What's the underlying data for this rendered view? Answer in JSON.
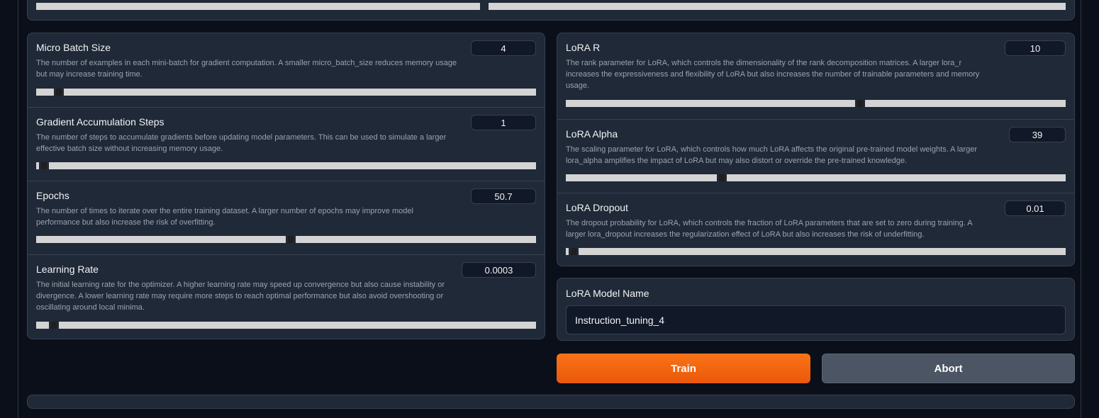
{
  "left_params": [
    {
      "label": "Micro Batch Size",
      "description_lines": [
        "The number of examples in each mini-batch for gradient computation. A smaller micro_batch_size reduces memory usage",
        "but may increase training time."
      ],
      "value": "4",
      "slider_fraction": 0.04
    },
    {
      "label": "Gradient Accumulation Steps",
      "description_lines": [
        "The number of steps to accumulate gradients before updating model parameters. This can be used to simulate a larger",
        "effective batch size without increasing memory usage."
      ],
      "value": "1",
      "slider_fraction": 0.01
    },
    {
      "label": "Epochs",
      "description_lines": [
        "The number of times to iterate over the entire training dataset. A larger number of epochs may improve model",
        "performance but also increase the risk of overfitting."
      ],
      "value": "50.7",
      "slider_fraction": 0.51
    },
    {
      "label": "Learning Rate",
      "description_lines": [
        "The initial learning rate for the optimizer. A higher learning rate may speed up convergence but also cause instability or",
        "divergence. A lower learning rate may require more steps to reach optimal performance but also avoid overshooting or",
        "oscillating around local minima."
      ],
      "value": "0.0003",
      "slider_fraction": 0.03
    }
  ],
  "right_params": [
    {
      "label": "LoRA R",
      "description_lines": [
        "The rank parameter for LoRA, which controls the dimensionality of the rank decomposition matrices. A larger lora_r",
        "increases the expressiveness and flexibility of LoRA but also increases the number of trainable parameters and memory",
        "usage."
      ],
      "value": "10",
      "slider_fraction": 0.59
    },
    {
      "label": "LoRA Alpha",
      "description_lines": [
        "The scaling parameter for LoRA, which controls how much LoRA affects the original pre-trained model weights. A larger",
        "lora_alpha amplifies the impact of LoRA but may also distort or override the pre-trained knowledge."
      ],
      "value": "39",
      "slider_fraction": 0.31
    },
    {
      "label": "LoRA Dropout",
      "description_lines": [
        "The dropout probability for LoRA, which controls the fraction of LoRA parameters that are set to zero during training. A",
        "larger lora_dropout increases the regularization effect of LoRA but also increases the risk of underfitting."
      ],
      "value": "0.01",
      "slider_fraction": 0.01
    }
  ],
  "model_name": {
    "label": "LoRA Model Name",
    "value": "Instruction_tuning_4"
  },
  "buttons": {
    "train_label": "Train",
    "abort_label": "Abort"
  },
  "colors": {
    "accent": "#f97316",
    "panel": "#1f2937",
    "background": "#0b0f19",
    "slider_track": "#d4d4d4"
  }
}
